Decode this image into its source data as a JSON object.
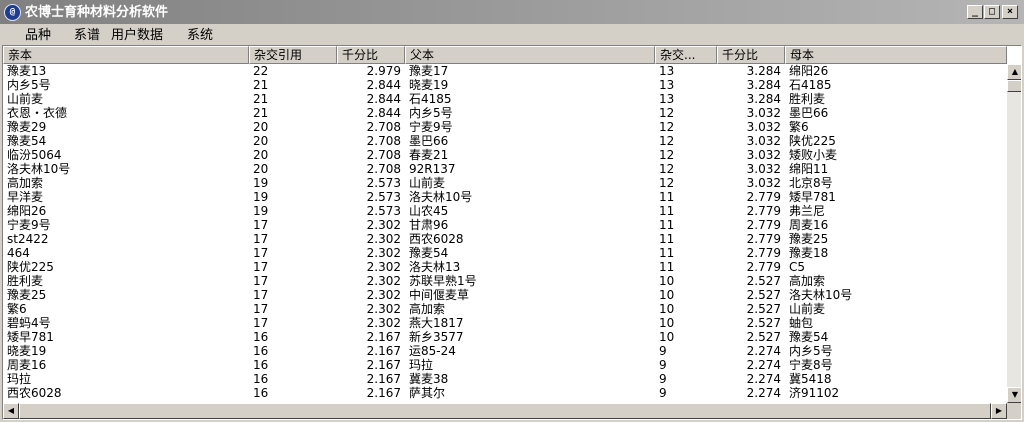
{
  "window": {
    "title": "农博士育种材料分析软件",
    "icon_label": "@"
  },
  "menu": {
    "items": [
      "品种",
      "系谱",
      "用户数据",
      "系统"
    ]
  },
  "table": {
    "columns": [
      "亲本",
      "杂交引用",
      "千分比",
      "父本",
      "杂交...",
      "千分比",
      "母本"
    ],
    "rows": [
      [
        "豫麦13",
        "22",
        "2.979",
        "豫麦17",
        "13",
        "3.284",
        "绵阳26"
      ],
      [
        "内乡5号",
        "21",
        "2.844",
        "晓麦19",
        "13",
        "3.284",
        "石4185"
      ],
      [
        "山前麦",
        "21",
        "2.844",
        "石4185",
        "13",
        "3.284",
        "胜利麦"
      ],
      [
        "衣恩・衣德",
        "21",
        "2.844",
        "内乡5号",
        "12",
        "3.032",
        "墨巴66"
      ],
      [
        "豫麦29",
        "20",
        "2.708",
        "宁麦9号",
        "12",
        "3.032",
        "繁6"
      ],
      [
        "豫麦54",
        "20",
        "2.708",
        "墨巴66",
        "12",
        "3.032",
        "陕优225"
      ],
      [
        "临汾5064",
        "20",
        "2.708",
        "春麦21",
        "12",
        "3.032",
        "矮败小麦"
      ],
      [
        "洛夫林10号",
        "20",
        "2.708",
        "92R137",
        "12",
        "3.032",
        "绵阳11"
      ],
      [
        "高加索",
        "19",
        "2.573",
        "山前麦",
        "12",
        "3.032",
        "北京8号"
      ],
      [
        "早洋麦",
        "19",
        "2.573",
        "洛夫林10号",
        "11",
        "2.779",
        "矮早781"
      ],
      [
        "绵阳26",
        "19",
        "2.573",
        "山农45",
        "11",
        "2.779",
        "弗兰尼"
      ],
      [
        "宁麦9号",
        "17",
        "2.302",
        "甘肃96",
        "11",
        "2.779",
        "周麦16"
      ],
      [
        "st2422",
        "17",
        "2.302",
        "西农6028",
        "11",
        "2.779",
        "豫麦25"
      ],
      [
        "464",
        "17",
        "2.302",
        "豫麦54",
        "11",
        "2.779",
        "豫麦18"
      ],
      [
        "陕优225",
        "17",
        "2.302",
        "洛夫林13",
        "11",
        "2.779",
        "C5"
      ],
      [
        "胜利麦",
        "17",
        "2.302",
        "苏联早熟1号",
        "10",
        "2.527",
        "高加索"
      ],
      [
        "豫麦25",
        "17",
        "2.302",
        "中间偃麦草",
        "10",
        "2.527",
        "洛夫林10号"
      ],
      [
        "繁6",
        "17",
        "2.302",
        "高加索",
        "10",
        "2.527",
        "山前麦"
      ],
      [
        "碧蚂4号",
        "17",
        "2.302",
        "燕大1817",
        "10",
        "2.527",
        "蚰包"
      ],
      [
        "矮早781",
        "16",
        "2.167",
        "新乡3577",
        "10",
        "2.527",
        "豫麦54"
      ],
      [
        "晓麦19",
        "16",
        "2.167",
        "运85-24",
        "9",
        "2.274",
        "内乡5号"
      ],
      [
        "周麦16",
        "16",
        "2.167",
        "玛拉",
        "9",
        "2.274",
        "宁麦8号"
      ],
      [
        "玛拉",
        "16",
        "2.167",
        "冀麦38",
        "9",
        "2.274",
        "冀5418"
      ],
      [
        "西农6028",
        "16",
        "2.167",
        "萨其尔",
        "9",
        "2.274",
        "济91102"
      ]
    ]
  }
}
